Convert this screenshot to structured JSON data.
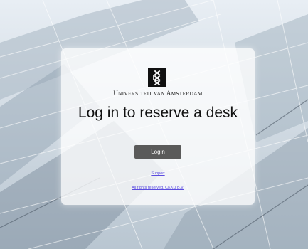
{
  "logo": {
    "icon": "xxx-shield-icon"
  },
  "university": {
    "first_initial": "U",
    "first_rest": "NIVERSITEIT",
    "middle": " VAN ",
    "last_initial": "A",
    "last_rest": "MSTERDAM"
  },
  "heading": "Log in to reserve a desk",
  "login_label": "Login",
  "support_link": "Support",
  "rights_link": "All rights reserved. CKKU B.V."
}
